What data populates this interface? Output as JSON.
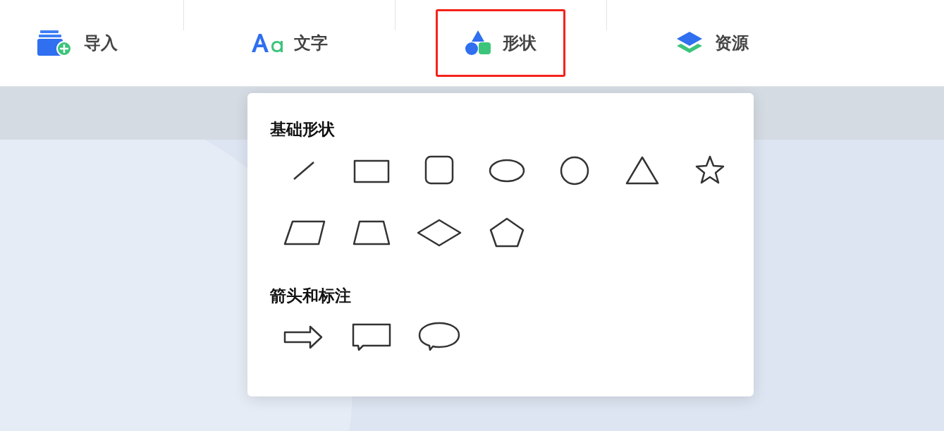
{
  "toolbar": {
    "tabs": [
      {
        "label": "导入",
        "kind": "import",
        "selected": false
      },
      {
        "label": "文字",
        "kind": "text",
        "selected": false
      },
      {
        "label": "形状",
        "kind": "shape",
        "selected": true
      },
      {
        "label": "资源",
        "kind": "resource",
        "selected": false
      }
    ]
  },
  "shape_panel": {
    "sections": [
      {
        "title": "基础形状",
        "shapes": [
          {
            "kind": "line"
          },
          {
            "kind": "rectangle"
          },
          {
            "kind": "rounded-rectangle"
          },
          {
            "kind": "ellipse"
          },
          {
            "kind": "circle"
          },
          {
            "kind": "triangle"
          },
          {
            "kind": "star"
          },
          {
            "kind": "parallelogram"
          },
          {
            "kind": "trapezoid"
          },
          {
            "kind": "diamond"
          },
          {
            "kind": "pentagon"
          }
        ]
      },
      {
        "title": "箭头和标注",
        "shapes": [
          {
            "kind": "arrow"
          },
          {
            "kind": "rectangle-callout"
          },
          {
            "kind": "oval-callout"
          }
        ]
      }
    ]
  }
}
